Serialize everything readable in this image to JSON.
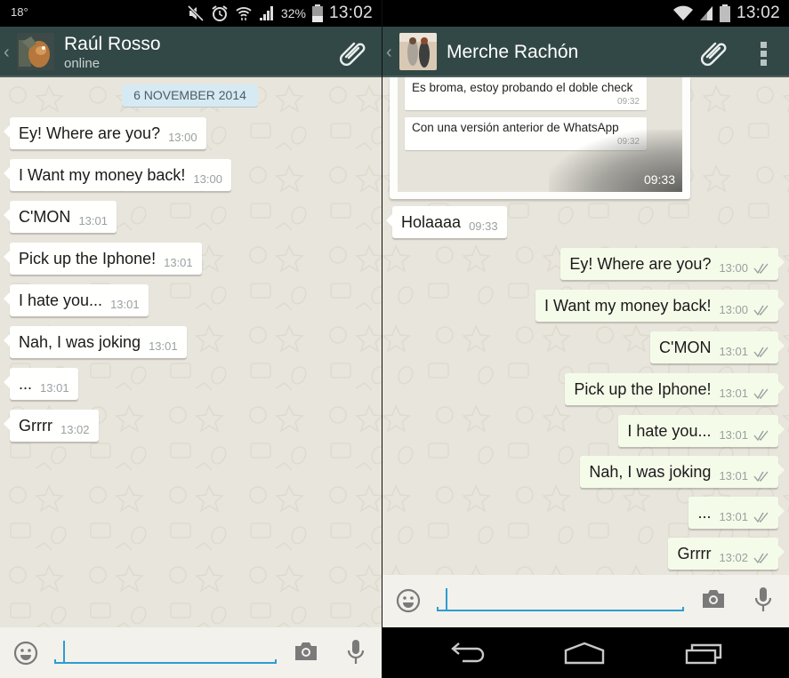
{
  "left_phone": {
    "status_bar": {
      "temperature": "18°",
      "battery_percent": "32%",
      "time": "13:02",
      "icons": [
        "mute-icon",
        "alarm-icon",
        "wifi-icon",
        "signal-icon",
        "battery-icon"
      ]
    },
    "header": {
      "back_icon": "chevron-left-icon",
      "contact_name": "Raúl Rosso",
      "status": "online",
      "attach_icon": "paperclip-icon"
    },
    "date_separator": "6 NOVEMBER 2014",
    "messages": [
      {
        "direction": "incoming",
        "text": "Ey! Where are you?",
        "time": "13:00"
      },
      {
        "direction": "incoming",
        "text": "I Want my money back!",
        "time": "13:00"
      },
      {
        "direction": "incoming",
        "text": "C'MON",
        "time": "13:01"
      },
      {
        "direction": "incoming",
        "text": "Pick up the Iphone!",
        "time": "13:01"
      },
      {
        "direction": "incoming",
        "text": "I hate you...",
        "time": "13:01"
      },
      {
        "direction": "incoming",
        "text": "Nah, I was joking",
        "time": "13:01"
      },
      {
        "direction": "incoming",
        "text": "...",
        "time": "13:01"
      },
      {
        "direction": "incoming",
        "text": "Grrrr",
        "time": "13:02"
      }
    ],
    "input_bar": {
      "emoji_icon": "smiley-icon",
      "message_value": "",
      "camera_icon": "camera-icon",
      "mic_icon": "microphone-icon"
    }
  },
  "right_phone": {
    "status_bar": {
      "time": "13:02",
      "icons": [
        "wifi-icon",
        "signal-icon",
        "battery-icon"
      ]
    },
    "header": {
      "back_icon": "chevron-left-icon",
      "contact_name": "Merche Rachón",
      "attach_icon": "paperclip-icon",
      "menu_icon": "overflow-menu-icon"
    },
    "image_message": {
      "embedded_messages": [
        {
          "text": "Es broma, estoy probando el doble check",
          "time": "09:32"
        },
        {
          "text": "Con una versión anterior de WhatsApp",
          "time": "09:32"
        }
      ],
      "time": "09:33"
    },
    "messages": [
      {
        "direction": "incoming",
        "text": "Holaaaa",
        "time": "09:33"
      },
      {
        "direction": "outgoing",
        "text": "Ey! Where are you?",
        "time": "13:00",
        "status": "delivered-double-check"
      },
      {
        "direction": "outgoing",
        "text": "I Want my money back!",
        "time": "13:00",
        "status": "delivered-double-check"
      },
      {
        "direction": "outgoing",
        "text": "C'MON",
        "time": "13:01",
        "status": "delivered-double-check"
      },
      {
        "direction": "outgoing",
        "text": "Pick up the Iphone!",
        "time": "13:01",
        "status": "delivered-double-check"
      },
      {
        "direction": "outgoing",
        "text": "I hate you...",
        "time": "13:01",
        "status": "delivered-double-check"
      },
      {
        "direction": "outgoing",
        "text": "Nah, I was joking",
        "time": "13:01",
        "status": "delivered-double-check"
      },
      {
        "direction": "outgoing",
        "text": "...",
        "time": "13:01",
        "status": "delivered-double-check"
      },
      {
        "direction": "outgoing",
        "text": "Grrrr",
        "time": "13:02",
        "status": "delivered-double-check"
      }
    ],
    "input_bar": {
      "emoji_icon": "smiley-icon",
      "message_value": "",
      "camera_icon": "camera-icon",
      "mic_icon": "microphone-icon"
    },
    "nav_bar": {
      "buttons": [
        "back-nav-icon",
        "home-nav-icon",
        "recents-nav-icon"
      ]
    }
  },
  "colors": {
    "action_bar": "#324846",
    "incoming_bubble": "#fffffe",
    "outgoing_bubble": "#f5fbe9",
    "date_pill": "#d6eaf3",
    "input_accent": "#2d9dd0",
    "chat_background": "#e8e5dc"
  }
}
